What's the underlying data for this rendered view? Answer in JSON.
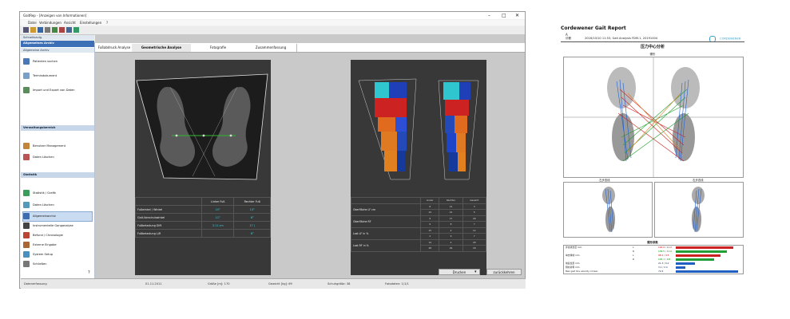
{
  "window": {
    "title": "GaitRep - [Anzeigen von Informationen]",
    "menu": [
      "Datei",
      "Verbindungen",
      "Ansicht",
      "Einstellungen",
      "?"
    ],
    "window_controls": [
      "–",
      "□",
      "✕"
    ]
  },
  "sidebar": {
    "header": "Schnellnavig.",
    "title": "Allgemeines Archiv",
    "group1": "Allgemeine Archiv",
    "items1": [
      {
        "label": "Patienten suchen",
        "icon": "patient-icon"
      },
      {
        "label": "Termindokument",
        "icon": "document-icon"
      },
      {
        "label": "Import und Export von Daten",
        "icon": "import-export-icon"
      }
    ],
    "group2": "Verwaltungsbereich",
    "items2": [
      {
        "label": "Benutzer Management",
        "icon": "users-icon"
      },
      {
        "label": "Daten Löschen",
        "icon": "delete-icon"
      }
    ],
    "group3": "Statistik",
    "items3": [
      {
        "label": "Statistik / Grafik",
        "icon": "chart-icon"
      },
      {
        "label": "Daten Löschen",
        "icon": "trash-icon"
      },
      {
        "label": "Allgemeinarchiv",
        "icon": "archive-icon"
      },
      {
        "label": "Instrumentelle Ganganalyse",
        "icon": "instrument-icon"
      },
      {
        "label": "Befund / Chronologie",
        "icon": "chronology-icon"
      },
      {
        "label": "Externe Eingabe",
        "icon": "external-icon"
      },
      {
        "label": "System Setup",
        "icon": "settings-icon"
      },
      {
        "label": "Schließen",
        "icon": "close-icon"
      }
    ]
  },
  "tabs": [
    "Fußabdruck Analyse",
    "Geometrische Analyse",
    "Fotografie",
    "Zusammenfassung"
  ],
  "left_table": {
    "headers": [
      "",
      "Linker Fuß",
      "Rechter Fuß"
    ],
    "rows": [
      {
        "label": "Fußwinkel / Winkel",
        "left": "15°",
        "right": "13°"
      },
      {
        "label": "Gait-Vorschubwinkel",
        "left": "11°",
        "right": "8°"
      },
      {
        "label": "Fußbelastung Diff.",
        "left": "3.11 cm",
        "right": "17 ("
      },
      {
        "label": "Fußbelastung L/R",
        "left": "",
        "right": "8°"
      }
    ]
  },
  "right_table": {
    "headers": [
      "",
      "Linker",
      "Rechter",
      "Gesamt"
    ],
    "rows": [
      {
        "label": "Oberfläche LF cm",
        "sub": [
          [
            "8",
            "12",
            "3",
            "8"
          ],
          [
            "12",
            "21",
            "5",
            "7"
          ]
        ]
      },
      {
        "label": "Oberfläche RF",
        "sub": [
          [
            "9",
            "17",
            "20",
            "5"
          ],
          [
            "9",
            "8",
            "7",
            "12"
          ]
        ]
      },
      {
        "label": "Last LF in %",
        "sub": [
          [
            "15",
            "4",
            "12",
            "19"
          ],
          [
            "2",
            "9",
            "7",
            "8"
          ]
        ]
      },
      {
        "label": "Last RF in %",
        "sub": [
          [
            "14",
            "4",
            "29",
            "38"
          ],
          [
            "28",
            "29",
            "18",
            "25"
          ]
        ]
      }
    ]
  },
  "buttons": {
    "print": "Drucken",
    "back": "zurückkehren"
  },
  "statusbar": [
    "Datenerfassung",
    "01.11.2011",
    "Größe [m]: 170",
    "Gewicht [kg]: 69",
    "Schuhgröße: 38",
    "Fotodaten: 1/1/1"
  ],
  "report": {
    "title": "Cordewener Gait Report",
    "logo": "CORDEWENER",
    "line1": "A",
    "line2": "诊断",
    "meta": "2016/10/10 11:53, Gait Analysis FDM-1, 20191004",
    "section": "压力中心分析",
    "subsection": "蝶形",
    "panel_left": "左步态线",
    "panel_right": "右步态线",
    "params_title": "蝶形参数",
    "params": [
      {
        "label": "步态线长度 mm",
        "lr": "L",
        "val": "126.9 / 11.0"
      },
      {
        "label": "",
        "lr": "R",
        "val": "136.5 / 11.0"
      },
      {
        "label": "单支撑线 mm",
        "lr": "L",
        "val": "98.2 / 9.5"
      },
      {
        "label": "",
        "lr": "R",
        "val": "105.1 / 9.8"
      },
      {
        "label": "前后位置 mm",
        "lr": "",
        "val": "21.3 / 6.2"
      },
      {
        "label": "侧向对称 mm",
        "lr": "",
        "val": "3.1 / 2.4"
      },
      {
        "label": "Max gait line velocity cm/sec",
        "lr": "",
        "val": "72.6"
      }
    ]
  }
}
